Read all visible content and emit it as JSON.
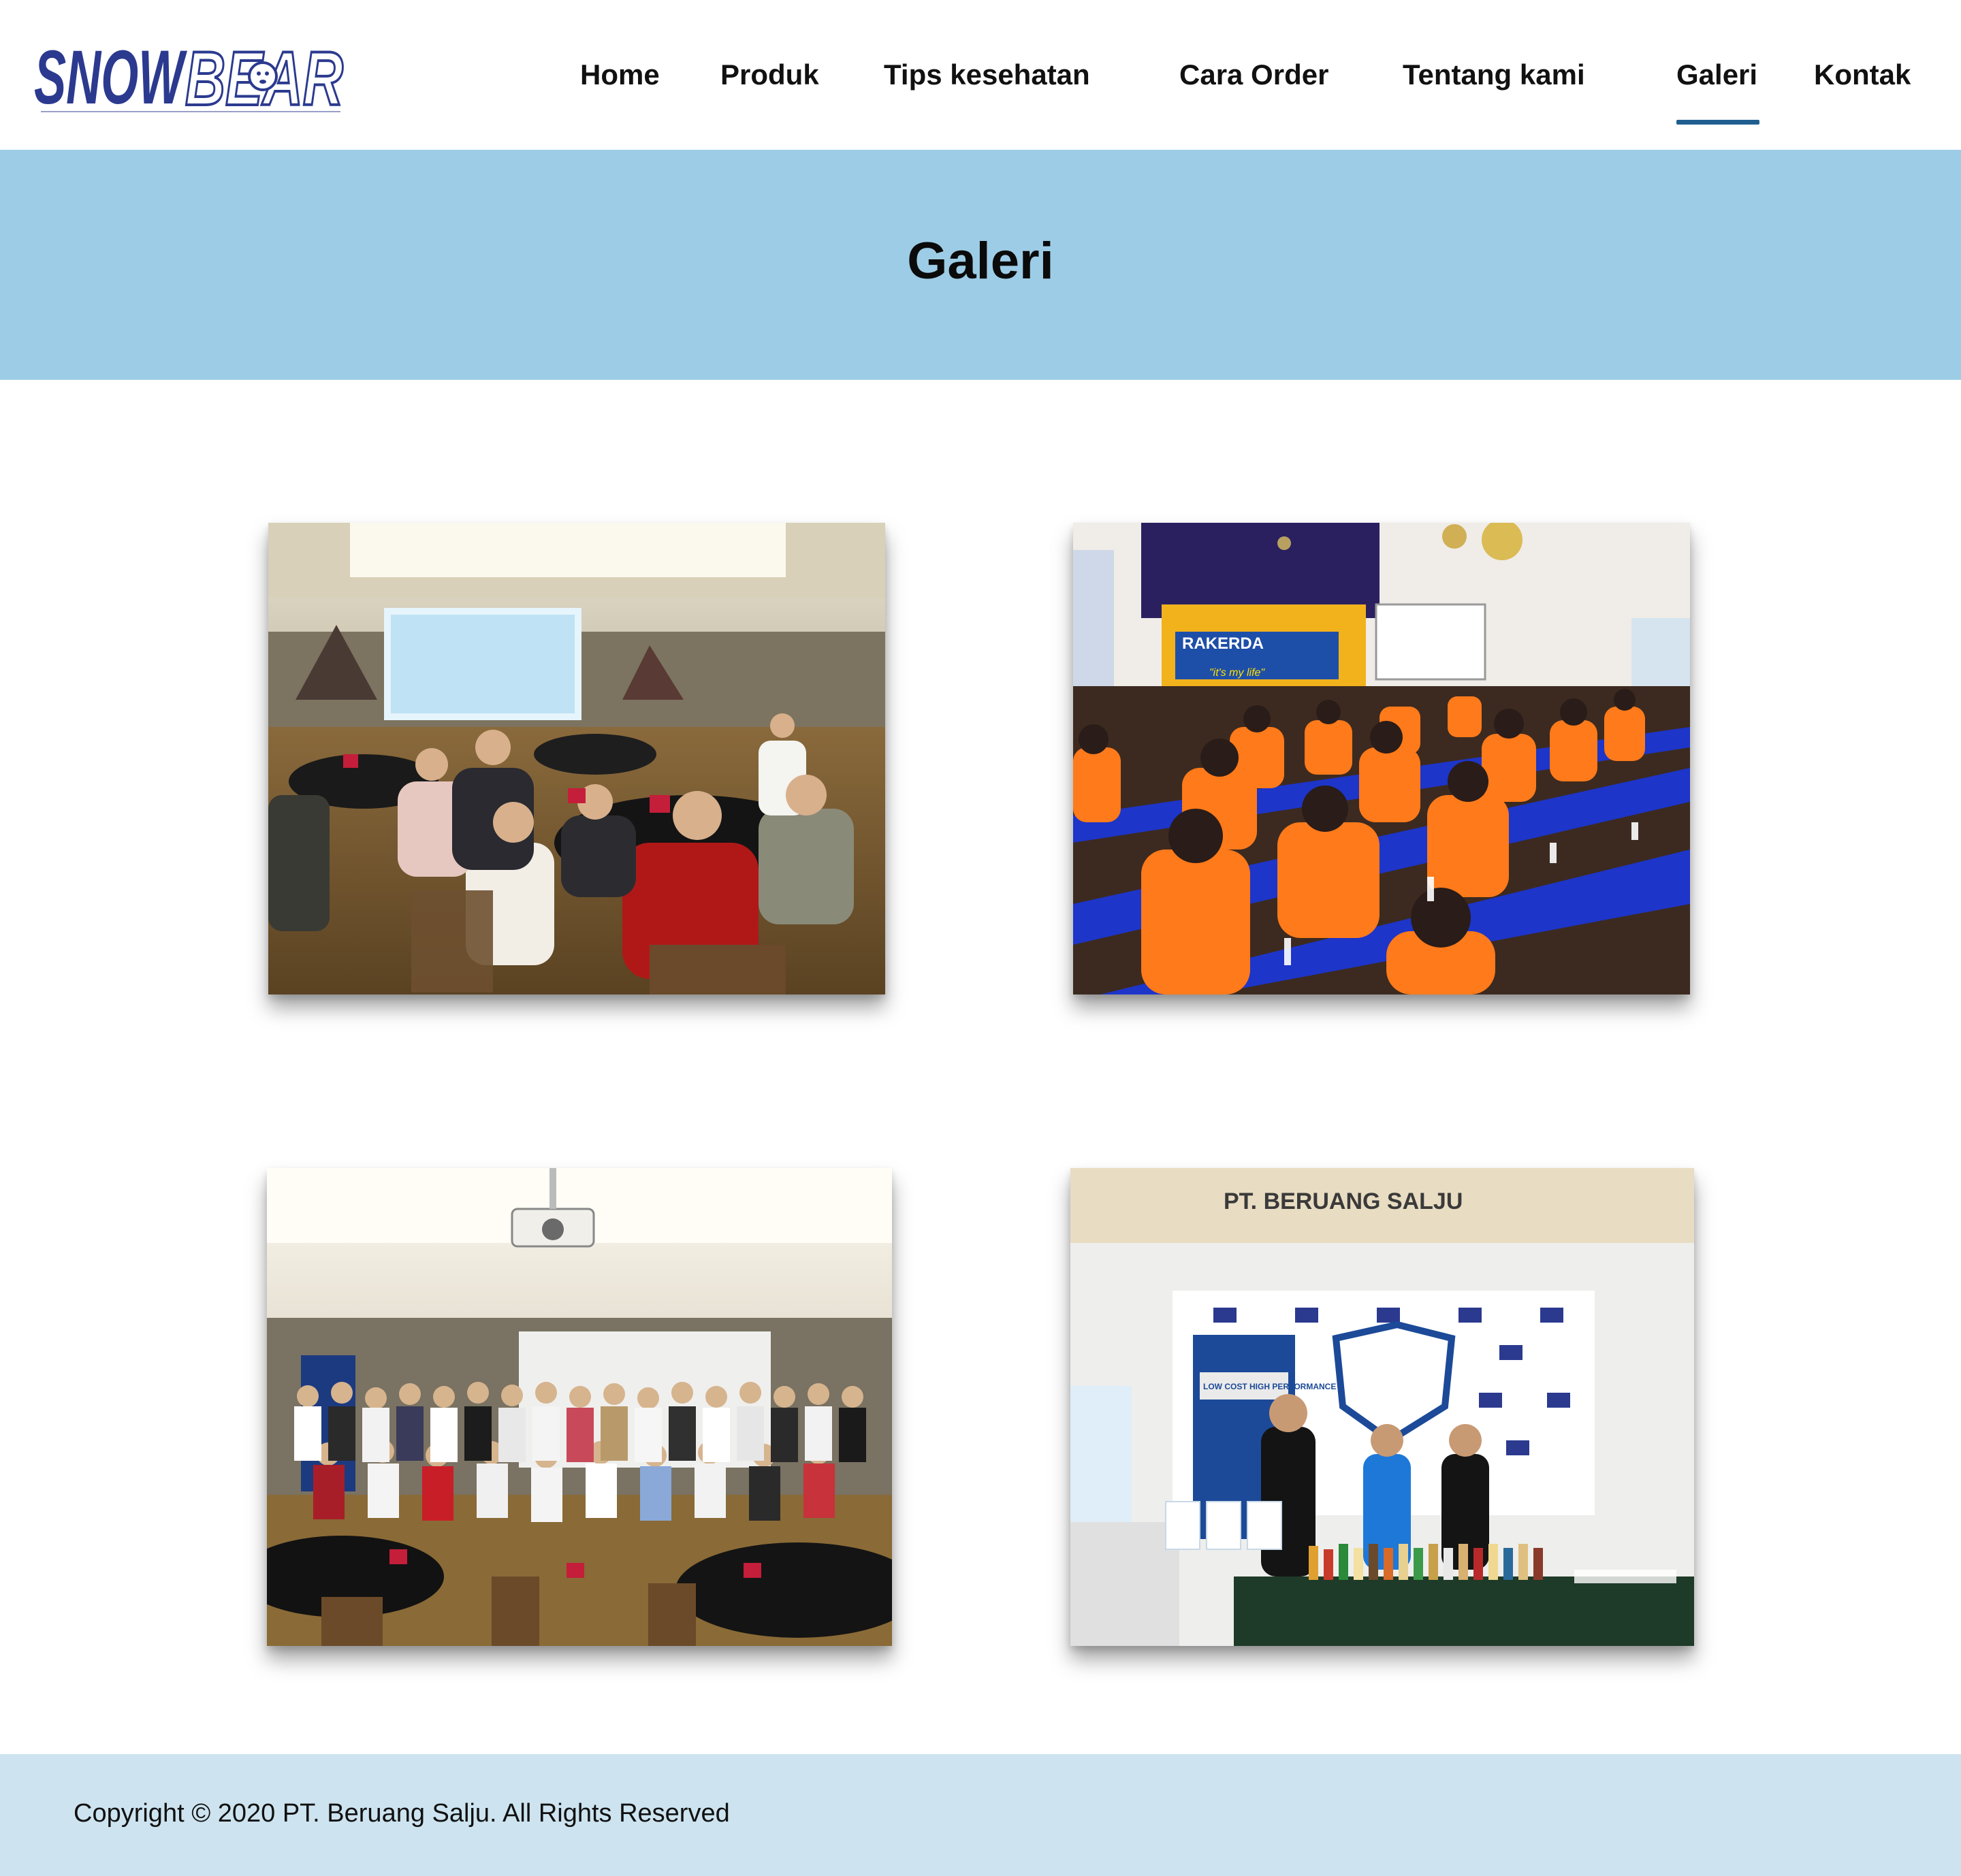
{
  "brand": {
    "logo_part1": "SNOW",
    "logo_part2": "BEAR",
    "primary_color": "#2b3a8f",
    "accent_color": "#1f5f8f"
  },
  "nav": {
    "items": [
      {
        "label": "Home",
        "active": false
      },
      {
        "label": "Produk",
        "active": false
      },
      {
        "label": "Tips kesehatan",
        "active": false
      },
      {
        "label": "Cara Order",
        "active": false
      },
      {
        "label": "Tentang kami",
        "active": false
      },
      {
        "label": "Galeri",
        "active": true
      },
      {
        "label": "Kontak",
        "active": false
      }
    ]
  },
  "banner": {
    "title": "Galeri",
    "background": "#9dcde6"
  },
  "gallery": {
    "photos": [
      {
        "subject": "seminar-meeting-room"
      },
      {
        "subject": "conference-hall-audience",
        "stage_text_1": "RAKERDA",
        "stage_text_2": "\"it's my life\""
      },
      {
        "subject": "group-photo"
      },
      {
        "subject": "exhibition-booth",
        "booth_sign": "PT. BERUANG SALJU",
        "poster_text": "LOW COST HIGH PERFORMANCE"
      }
    ]
  },
  "footer": {
    "copyright": "Copyright © 2020 PT. Beruang Salju. All Rights Reserved",
    "background": "#cde4f0"
  }
}
